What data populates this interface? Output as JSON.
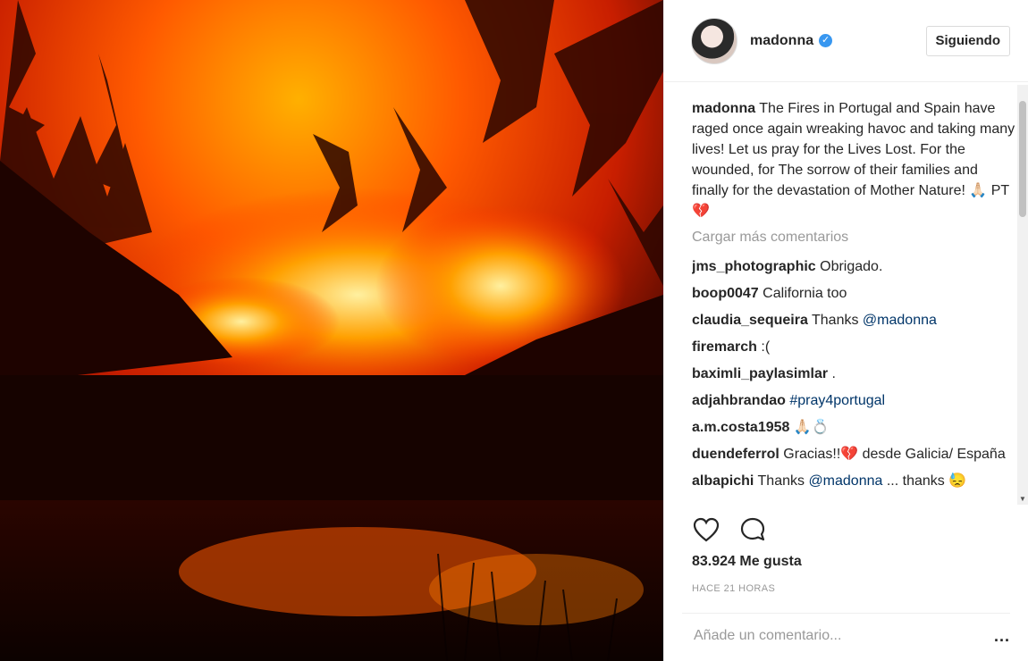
{
  "post": {
    "image_alt": "forest fire at night reflected in a river",
    "username": "madonna",
    "follow_label": "Siguiendo",
    "caption_user": "madonna",
    "caption_text": " The Fires in Portugal and Spain have raged once again wreaking havoc and taking many lives! Let us pray for the Lives Lost. For the wounded, for The sorrow of their families and finally for the devastation of Mother Nature! 🙏🏻 PT💔",
    "load_more": "Cargar más comentarios",
    "comments": [
      {
        "user": "jms_photographic",
        "text": " Obrigado."
      },
      {
        "user": "boop0047",
        "text": " California too"
      },
      {
        "user": "claudia_sequeira",
        "text": " Thanks ",
        "mention": "@madonna"
      },
      {
        "user": "firemarch",
        "text": " :("
      },
      {
        "user": "baximli_paylasimlar",
        "text": " ."
      },
      {
        "user": "adjahbrandao",
        "text": " ",
        "mention": "#pray4portugal"
      },
      {
        "user": "a.m.costa1958",
        "text": " 🙏🏻💍"
      },
      {
        "user": "duendeferrol",
        "text": " Gracias!!💔 desde Galicia/ España"
      },
      {
        "user": "albapichi",
        "text": " Thanks ",
        "mention": "@madonna",
        "tail": " ... thanks 😓"
      }
    ],
    "likes": "83.924 Me gusta",
    "time": "HACE 21 HORAS",
    "comment_placeholder": "Añade un comentario...",
    "more_label": "..."
  },
  "icons": {
    "like": "heart-icon",
    "comment": "comment-bubble-icon",
    "verified": "verified-badge-icon",
    "more": "more-options-icon"
  },
  "colors": {
    "mention": "#003569",
    "verified": "#3897f0",
    "muted": "#999999"
  }
}
